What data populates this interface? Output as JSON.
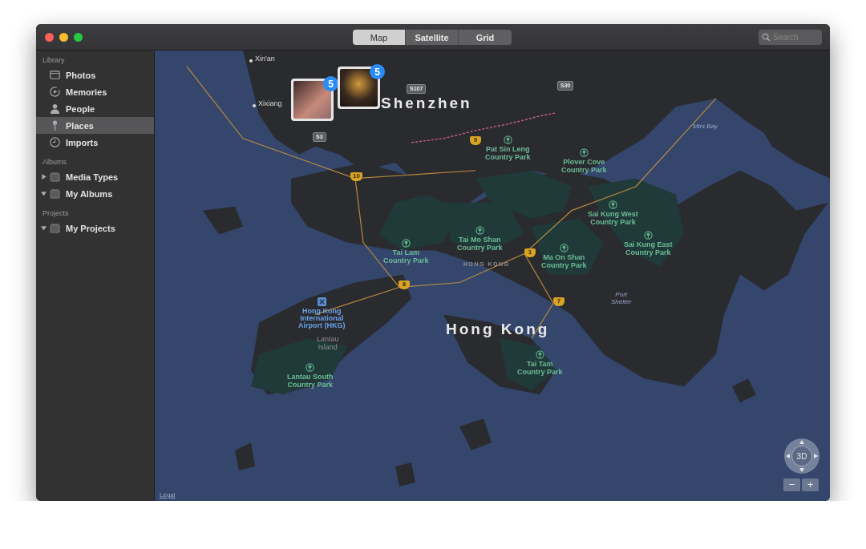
{
  "toolbar": {
    "view_tabs": [
      {
        "label": "Map",
        "selected": true
      },
      {
        "label": "Satellite",
        "selected": false
      },
      {
        "label": "Grid",
        "selected": false
      }
    ],
    "search": {
      "placeholder": "Search"
    }
  },
  "sidebar": {
    "sections": [
      {
        "heading": "Library",
        "items": [
          {
            "label": "Photos",
            "selected": false
          },
          {
            "label": "Memories",
            "selected": false
          },
          {
            "label": "People",
            "selected": false
          },
          {
            "label": "Places",
            "selected": true
          },
          {
            "label": "Imports",
            "selected": false
          }
        ]
      },
      {
        "heading": "Albums",
        "items": [
          {
            "label": "Media Types",
            "selected": false,
            "expanded": false
          },
          {
            "label": "My Albums",
            "selected": false,
            "expanded": true
          }
        ]
      },
      {
        "heading": "Projects",
        "items": [
          {
            "label": "My Projects",
            "selected": false,
            "expanded": true
          }
        ]
      }
    ]
  },
  "map": {
    "labels": [
      {
        "text": "Xin'an",
        "kind": "town"
      },
      {
        "text": "Xixiang",
        "kind": "town"
      },
      {
        "text": "Shenzhen",
        "kind": "city"
      },
      {
        "text": "Hong Kong",
        "kind": "city"
      },
      {
        "text": "HONG KONG",
        "kind": "district"
      },
      {
        "text": "Pat Sin Leng\nCountry Park",
        "kind": "park"
      },
      {
        "text": "Plover Cove\nCountry Park",
        "kind": "park"
      },
      {
        "text": "Tai Mo Shan\nCountry Park",
        "kind": "park"
      },
      {
        "text": "Tai Lam\nCountry Park",
        "kind": "park"
      },
      {
        "text": "Ma On Shan\nCountry Park",
        "kind": "park"
      },
      {
        "text": "Sai Kung West\nCountry Park",
        "kind": "park"
      },
      {
        "text": "Sai Kung East\nCountry Park",
        "kind": "park"
      },
      {
        "text": "Tai Tam\nCountry Park",
        "kind": "park"
      },
      {
        "text": "Hong Kong\nInternational\nAirport (HKG)",
        "kind": "airport"
      },
      {
        "text": "Lantau\nIsland",
        "kind": "island"
      },
      {
        "text": "Lantau South\nCountry Park",
        "kind": "park"
      },
      {
        "text": "Port\nShelter",
        "kind": "water"
      },
      {
        "text": "Mirs Bay",
        "kind": "water"
      },
      {
        "text": "S107",
        "kind": "road"
      },
      {
        "text": "S30",
        "kind": "road"
      },
      {
        "text": "S3",
        "kind": "road"
      },
      {
        "text": "9",
        "kind": "highway"
      },
      {
        "text": "10",
        "kind": "highway"
      },
      {
        "text": "1",
        "kind": "highway"
      },
      {
        "text": "8",
        "kind": "highway"
      },
      {
        "text": "7",
        "kind": "highway"
      }
    ],
    "photo_pins": [
      {
        "count": "5"
      },
      {
        "count": "5"
      }
    ],
    "compass": {
      "label": "3D"
    },
    "zoom_buttons": [
      "−",
      "+"
    ],
    "legal": "Legal"
  }
}
